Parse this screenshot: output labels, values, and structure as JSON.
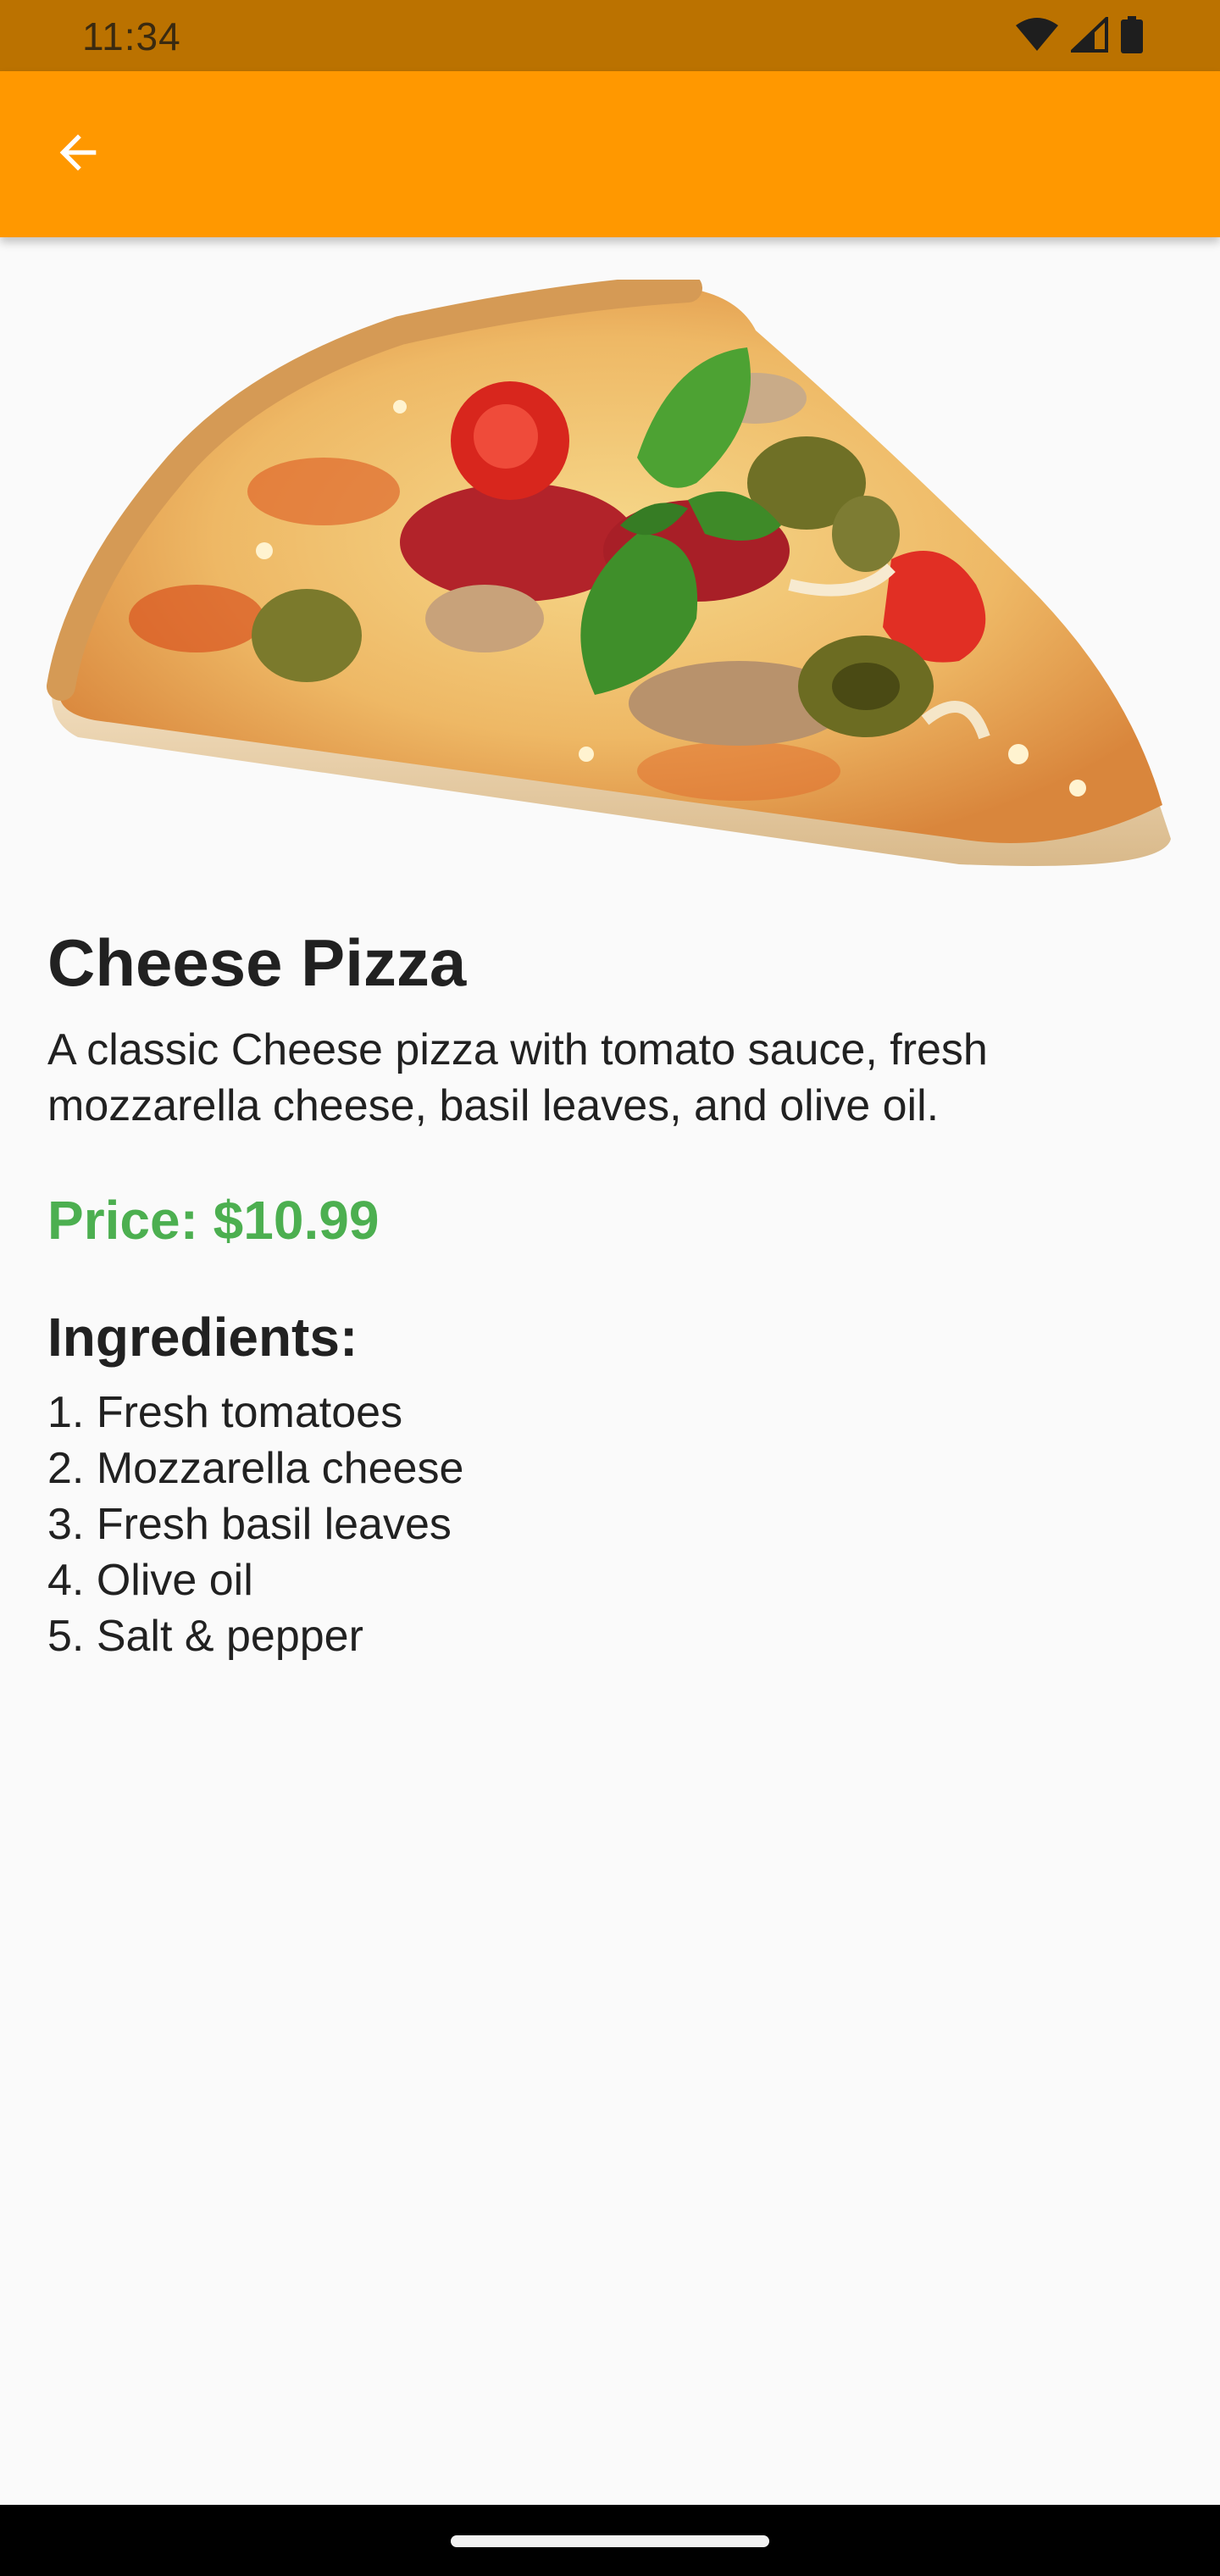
{
  "status_bar": {
    "time": "11:34",
    "icons": [
      "wifi-icon",
      "cellular-signal-icon",
      "battery-icon"
    ],
    "color": "#bb7200"
  },
  "app_bar": {
    "back_icon": "arrow-back-icon",
    "color": "#ff9800"
  },
  "hero_image": {
    "subject": "pizza slice"
  },
  "product": {
    "title": "Cheese Pizza",
    "description": "A classic Cheese pizza with tomato sauce, fresh mozzarella cheese, basil leaves, and olive oil.",
    "price": "Price: $10.99",
    "price_color": "#4caf50"
  },
  "ingredients": {
    "heading": "Ingredients:",
    "items": [
      "1. Fresh tomatoes",
      "2. Mozzarella cheese",
      "3. Fresh basil leaves",
      "4. Olive oil",
      "5. Salt & pepper"
    ]
  }
}
